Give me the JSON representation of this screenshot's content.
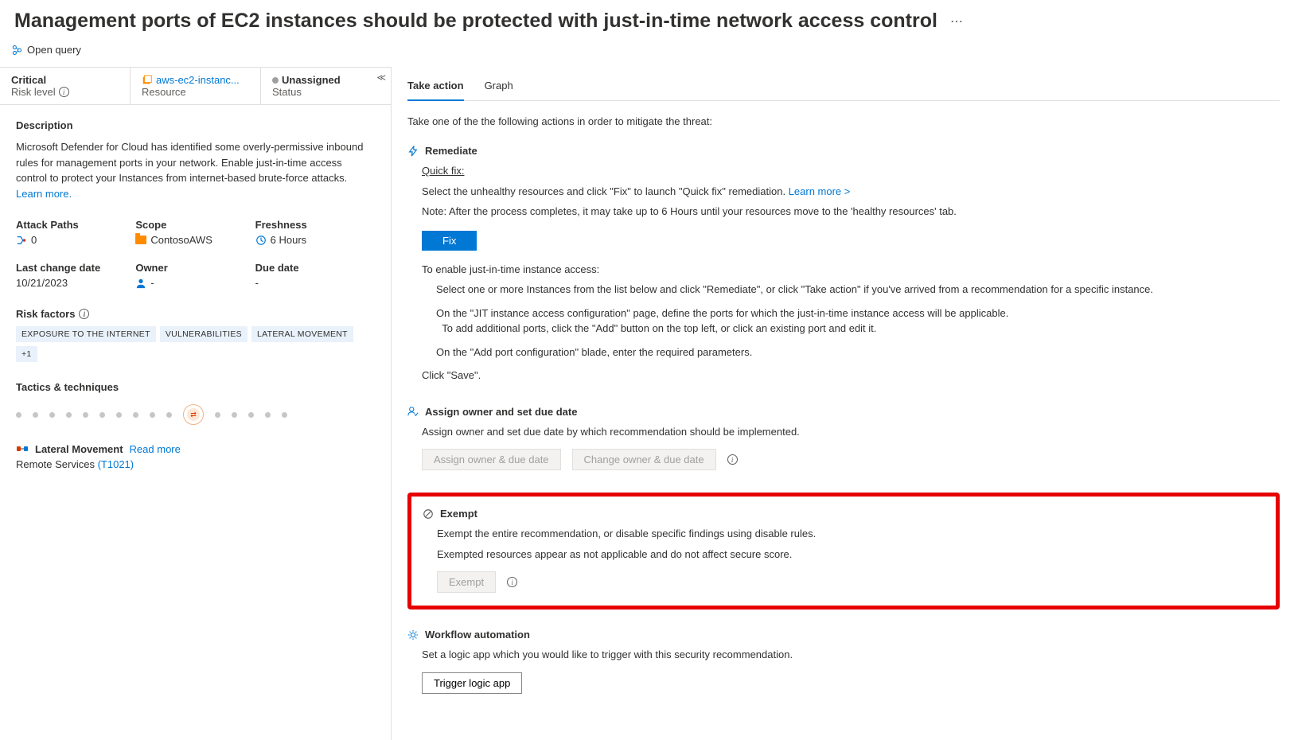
{
  "title": "Management ports of EC2 instances should be protected with just-in-time network access control",
  "open_query": "Open query",
  "header_cells": {
    "critical": "Critical",
    "risk_level": "Risk level",
    "resource_name": "aws-ec2-instanc...",
    "resource_label": "Resource",
    "status_value": "Unassigned",
    "status_label": "Status"
  },
  "left": {
    "description_heading": "Description",
    "description_body": "Microsoft Defender for Cloud has identified some overly-permissive inbound rules for management ports in your network. Enable just-in-time access control to protect your Instances from internet-based brute-force attacks. ",
    "learn_more": "Learn more.",
    "meta": {
      "attack_paths": {
        "label": "Attack Paths",
        "value": "0"
      },
      "scope": {
        "label": "Scope",
        "value": "ContosoAWS"
      },
      "freshness": {
        "label": "Freshness",
        "value": "6 Hours"
      },
      "last_change": {
        "label": "Last change date",
        "value": "10/21/2023"
      },
      "owner": {
        "label": "Owner",
        "value": "-"
      },
      "due_date": {
        "label": "Due date",
        "value": "-"
      }
    },
    "risk_factors_heading": "Risk factors",
    "risk_tags": [
      "EXPOSURE TO THE INTERNET",
      "VULNERABILITIES",
      "LATERAL MOVEMENT",
      "+1"
    ],
    "tactics_heading": "Tactics & techniques",
    "lateral": {
      "title": "Lateral Movement",
      "read_more": "Read more",
      "sub": "Remote Services ",
      "sub_link": "(T1021)"
    }
  },
  "right": {
    "tab_take": "Take action",
    "tab_graph": "Graph",
    "intro": "Take one of the the following actions in order to mitigate the threat:",
    "remediate": {
      "title": "Remediate",
      "quick": "Quick fix:",
      "line1": "Select the unhealthy resources and click \"Fix\" to launch \"Quick fix\" remediation. ",
      "learn": "Learn more >",
      "line2": "Note: After the process completes, it may take up to 6 Hours until your resources move to the 'healthy resources' tab.",
      "fix": "Fix",
      "enable": "To enable just-in-time instance access:",
      "step1": "Select one or more Instances from the list below and click \"Remediate\", or click \"Take action\" if you've arrived from a recommendation for a specific instance.",
      "step2": "On the \"JIT instance access configuration\" page, define the ports for which the just-in-time instance access will be applicable.",
      "step2b": "To add additional ports, click the \"Add\" button on the top left, or click an existing port and edit it.",
      "step3": "On the \"Add port configuration\" blade, enter the required parameters.",
      "step4": "Click \"Save\"."
    },
    "assign": {
      "title": "Assign owner and set due date",
      "body": "Assign owner and set due date by which recommendation should be implemented.",
      "btn1": "Assign owner & due date",
      "btn2": "Change owner & due date"
    },
    "exempt": {
      "title": "Exempt",
      "body1": "Exempt the entire recommendation, or disable specific findings using disable rules.",
      "body2": "Exempted resources appear as not applicable and do not affect secure score.",
      "btn": "Exempt"
    },
    "workflow": {
      "title": "Workflow automation",
      "body": "Set a logic app which you would like to trigger with this security recommendation.",
      "btn": "Trigger logic app"
    }
  }
}
